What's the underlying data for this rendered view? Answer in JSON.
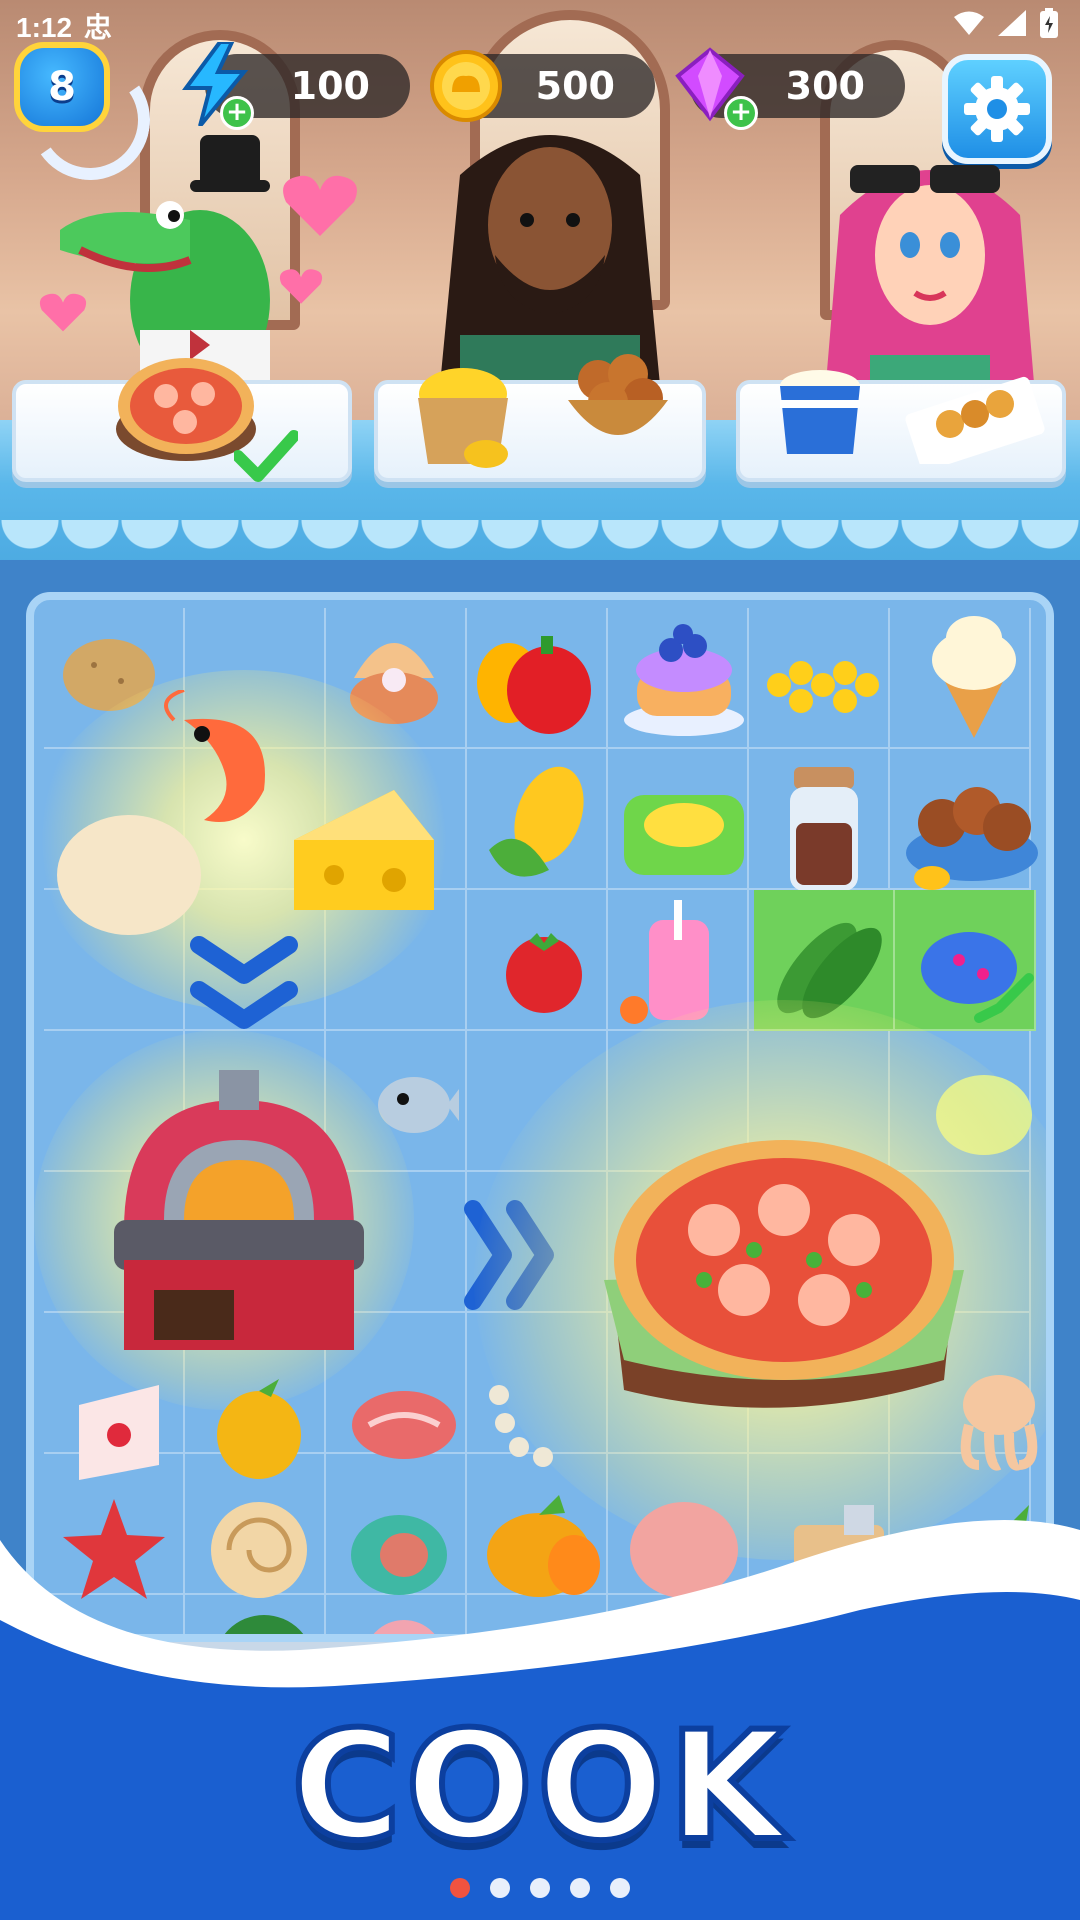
{
  "status_bar": {
    "time": "1:12",
    "extra_glyph": "忠",
    "icons": [
      "wifi-icon",
      "signal-icon",
      "battery-icon"
    ]
  },
  "hud": {
    "level": "8",
    "energy": {
      "value": "100",
      "icon": "lightning-icon"
    },
    "coins": {
      "value": "500",
      "icon": "chef-coin-icon"
    },
    "gems": {
      "value": "300",
      "icon": "gem-icon"
    },
    "settings_icon": "gear-icon"
  },
  "customers": [
    {
      "name": "crocodile-chef",
      "order": [
        "shrimp-pizza"
      ],
      "order_fulfilled": true
    },
    {
      "name": "bearded-man",
      "order": [
        "corn-basket",
        "bread-bowl"
      ],
      "order_fulfilled": false
    },
    {
      "name": "pink-haired-woman",
      "order": [
        "yogurt-cup",
        "grilled-skewers"
      ],
      "order_fulfilled": false
    }
  ],
  "board_items": [
    "potato",
    "clam-pearl",
    "bell-peppers",
    "blueberry-cake",
    "corn-kernels",
    "ice-cream-cone",
    "shrimp",
    "dough-ball",
    "cheese",
    "corn-cob",
    "corn-dish",
    "spice-jar",
    "roasted-chestnuts",
    "tomato",
    "smoothie-cup",
    "cucumbers",
    "blue-lobster",
    "fish",
    "lettuce",
    "brick-oven",
    "shrimp-pizza",
    "cake-slice",
    "golden-berry",
    "raw-steak",
    "pearl-necklace",
    "octopus",
    "starfish",
    "seashell",
    "spiral-shell",
    "mango",
    "ham",
    "chopping-board",
    "eggplant",
    "watermelon",
    "meat-slice"
  ],
  "colors": {
    "board_blue": "#7ab6ea",
    "accent_blue": "#1f8fe6",
    "title_stroke": "#0c3f9f",
    "active_dot": "#f05340"
  },
  "promo": {
    "title": "COOK",
    "page_count": 5,
    "active_page": 1
  }
}
